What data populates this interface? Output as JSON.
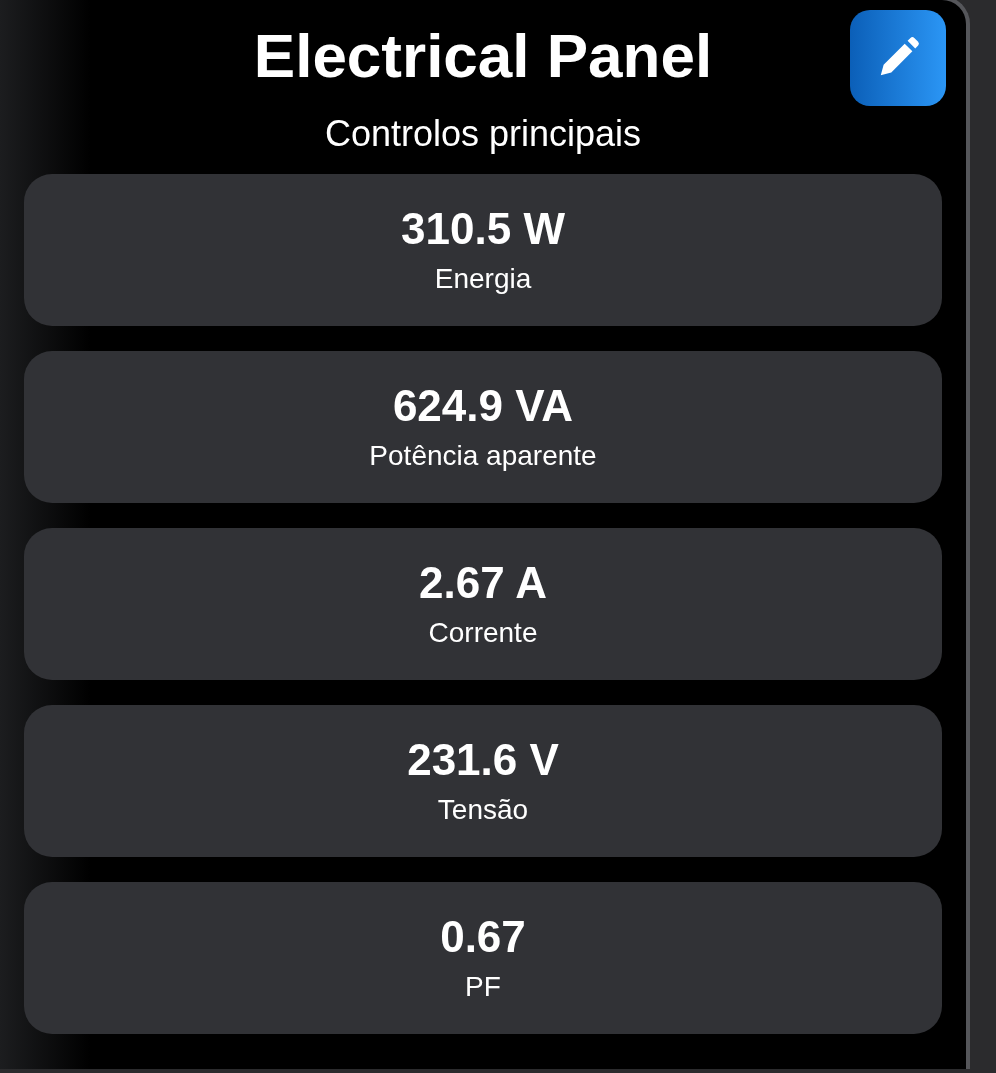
{
  "header": {
    "title": "Electrical Panel",
    "subtitle": "Controlos principais"
  },
  "readings": [
    {
      "value": "310.5 W",
      "label": "Energia"
    },
    {
      "value": "624.9 VA",
      "label": "Potência aparente"
    },
    {
      "value": "2.67 A",
      "label": "Corrente"
    },
    {
      "value": "231.6 V",
      "label": "Tensão"
    },
    {
      "value": "0.67",
      "label": "PF"
    }
  ]
}
